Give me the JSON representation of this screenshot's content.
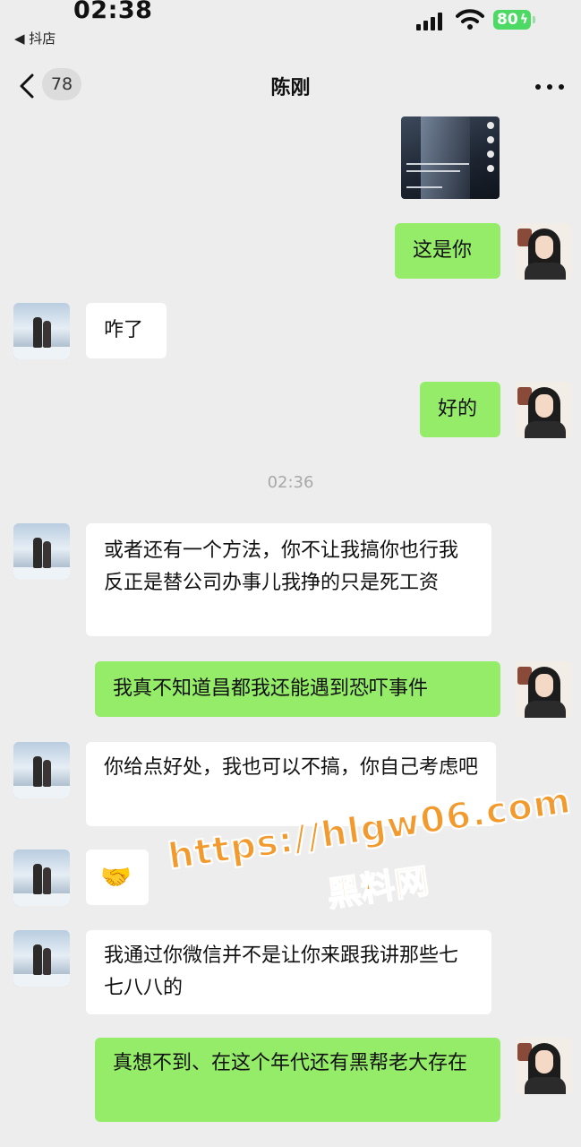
{
  "status_bar": {
    "time": "02:38",
    "back_app": "◀ 抖店",
    "battery": "80"
  },
  "nav": {
    "unread_count": "78",
    "title": "陈刚"
  },
  "messages": [
    {
      "from": "self",
      "text": "这是你"
    },
    {
      "from": "other",
      "text": "咋了"
    },
    {
      "from": "self",
      "text": "好的"
    },
    {
      "from": "other",
      "text": "或者还有一个方法，你不让我搞你也行我反正是替公司办事儿我挣的只是死工资"
    },
    {
      "from": "self",
      "text": "我真不知道昌都我还能遇到恐吓事件"
    },
    {
      "from": "other",
      "text": " 你给点好处，我也可以不搞，你自己考虑吧"
    },
    {
      "from": "other",
      "text": "🤝"
    },
    {
      "from": "other",
      "text": "我通过你微信并不是让你来跟我讲那些七七八八的"
    },
    {
      "from": "self",
      "text": "真想不到、在这个年代还有黑帮老大存在"
    }
  ],
  "time_divider": "02:36",
  "watermark": {
    "url": "https://hlgw06.com",
    "site": "黑料网"
  },
  "colors": {
    "background": "#ededed",
    "self_bubble": "#95ec69",
    "other_bubble": "#ffffff",
    "battery": "#4cd964",
    "watermark": "#f29a2e"
  }
}
